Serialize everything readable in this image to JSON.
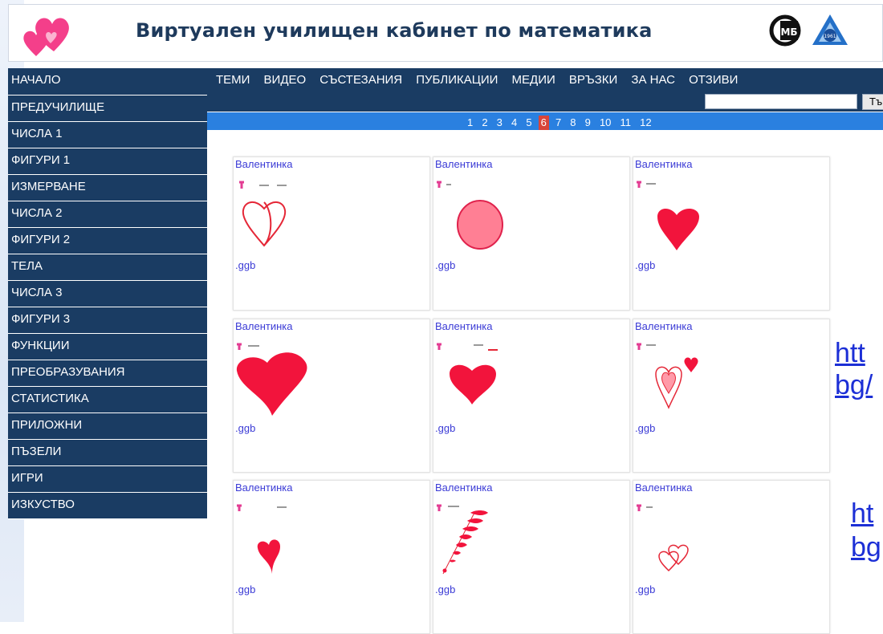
{
  "header": {
    "title": "Виртуален училищен кабинет по математика"
  },
  "sidebar": {
    "items": [
      {
        "label": "НАЧАЛО"
      },
      {
        "label": "ПРЕДУЧИЛИЩЕ"
      },
      {
        "label": "ЧИСЛА 1"
      },
      {
        "label": "ФИГУРИ 1"
      },
      {
        "label": "ИЗМЕРВАНЕ"
      },
      {
        "label": "ЧИСЛА 2"
      },
      {
        "label": "ФИГУРИ 2"
      },
      {
        "label": "ТЕЛА"
      },
      {
        "label": "ЧИСЛА 3"
      },
      {
        "label": "ФИГУРИ 3"
      },
      {
        "label": "ФУНКЦИИ"
      },
      {
        "label": "ПРЕОБРАЗУВАНИЯ"
      },
      {
        "label": "СТАТИСТИКА"
      },
      {
        "label": "ПРИЛОЖНИ"
      },
      {
        "label": "ПЪЗЕЛИ"
      },
      {
        "label": "ИГРИ"
      },
      {
        "label": "ИЗКУСТВО"
      }
    ]
  },
  "topnav": {
    "items": [
      {
        "label": "ТЕМИ"
      },
      {
        "label": "ВИДЕО"
      },
      {
        "label": "СЪСТЕЗАНИЯ"
      },
      {
        "label": "ПУБЛИКАЦИИ"
      },
      {
        "label": "МЕДИИ"
      },
      {
        "label": "ВРЪЗКИ"
      },
      {
        "label": "ЗА НАС"
      },
      {
        "label": "ОТЗИВИ"
      }
    ]
  },
  "search": {
    "value": "",
    "button_label": "Тъ"
  },
  "pager": {
    "pages": [
      "1",
      "2",
      "3",
      "4",
      "5",
      "6",
      "7",
      "8",
      "9",
      "10",
      "11",
      "12"
    ],
    "current": "6"
  },
  "cards": {
    "c0": {
      "title": "Валентинка",
      "ext": ".ggb"
    },
    "c1": {
      "title": "Валентинка",
      "ext": ".ggb"
    },
    "c2": {
      "title": "Валентинка",
      "ext": ".ggb"
    },
    "c3": {
      "title": "Валентинка",
      "ext": ".ggb"
    },
    "c4": {
      "title": "Валентинка",
      "ext": ".ggb"
    },
    "c5": {
      "title": "Валентинка",
      "ext": ".ggb"
    },
    "c6": {
      "title": "Валентинка",
      "ext": ".ggb"
    },
    "c7": {
      "title": "Валентинка",
      "ext": ".ggb"
    },
    "c8": {
      "title": "Валентинка",
      "ext": ".ggb"
    }
  },
  "links": {
    "a_line1": "htt",
    "a_line2": "bg/",
    "b_line1": "ht",
    "b_line2": "bg"
  },
  "colors": {
    "nav_bg": "#1a3c63",
    "pager_bg": "#2a80e0",
    "active_page": "#d9453a",
    "heart_red": "#f2143c",
    "heart_pink": "#ff7f94",
    "link_blue": "#3b3bd6"
  }
}
